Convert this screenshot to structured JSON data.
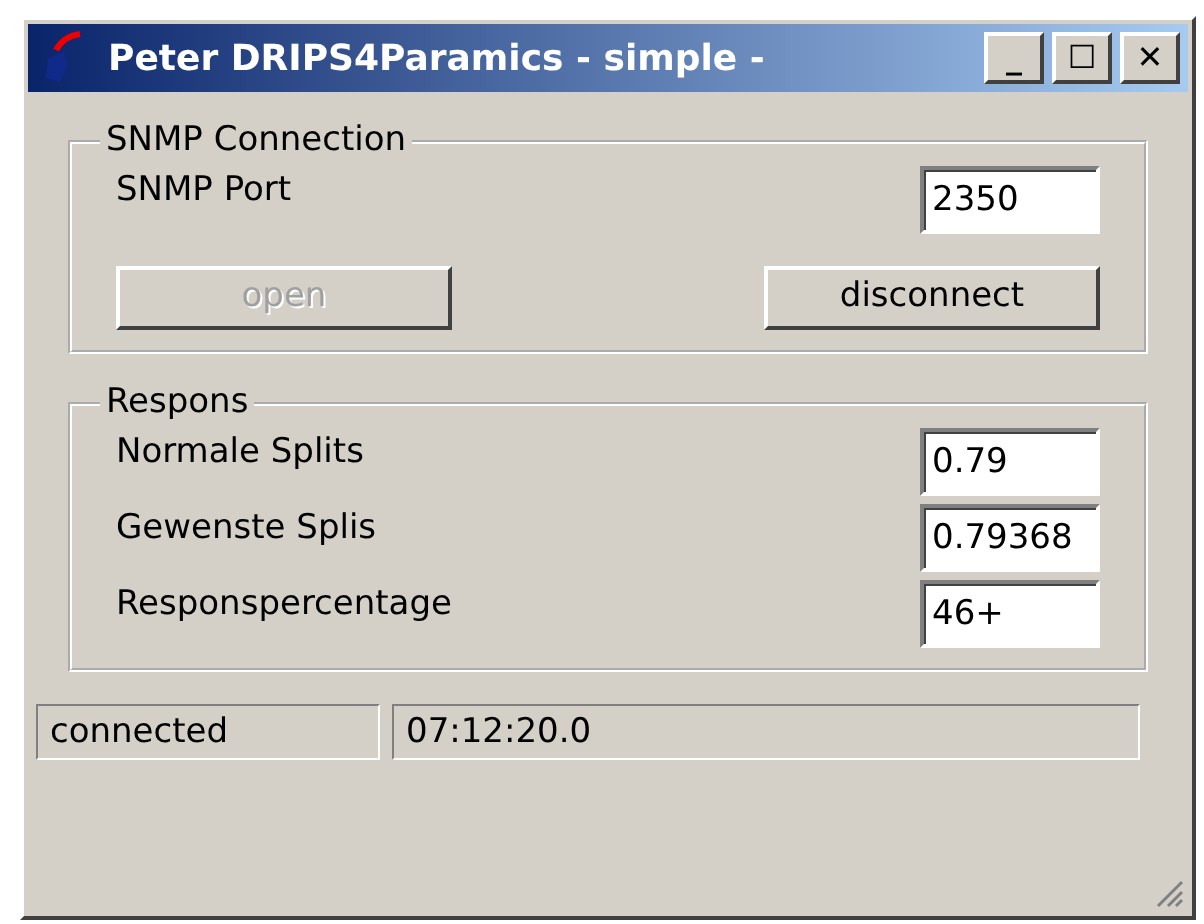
{
  "window": {
    "title": "Peter DRIPS4Paramics - simple -",
    "controls": [
      "_",
      "☐",
      "✕"
    ]
  },
  "snmp": {
    "legend": "SNMP Connection",
    "port_label": "SNMP Port",
    "port_value": "2350",
    "buttons": [
      {
        "label": "open",
        "disabled": true
      },
      {
        "label": "disconnect",
        "disabled": false
      }
    ]
  },
  "respons": {
    "legend": "Respons",
    "fields": [
      {
        "label": "Normale Splits",
        "value": "0.79"
      },
      {
        "label": "Gewenste Splis",
        "value": "0.79368"
      },
      {
        "label": "Responspercentage",
        "value": "46+"
      }
    ]
  },
  "status_bar": [
    "connected",
    "07:12:20.0"
  ]
}
